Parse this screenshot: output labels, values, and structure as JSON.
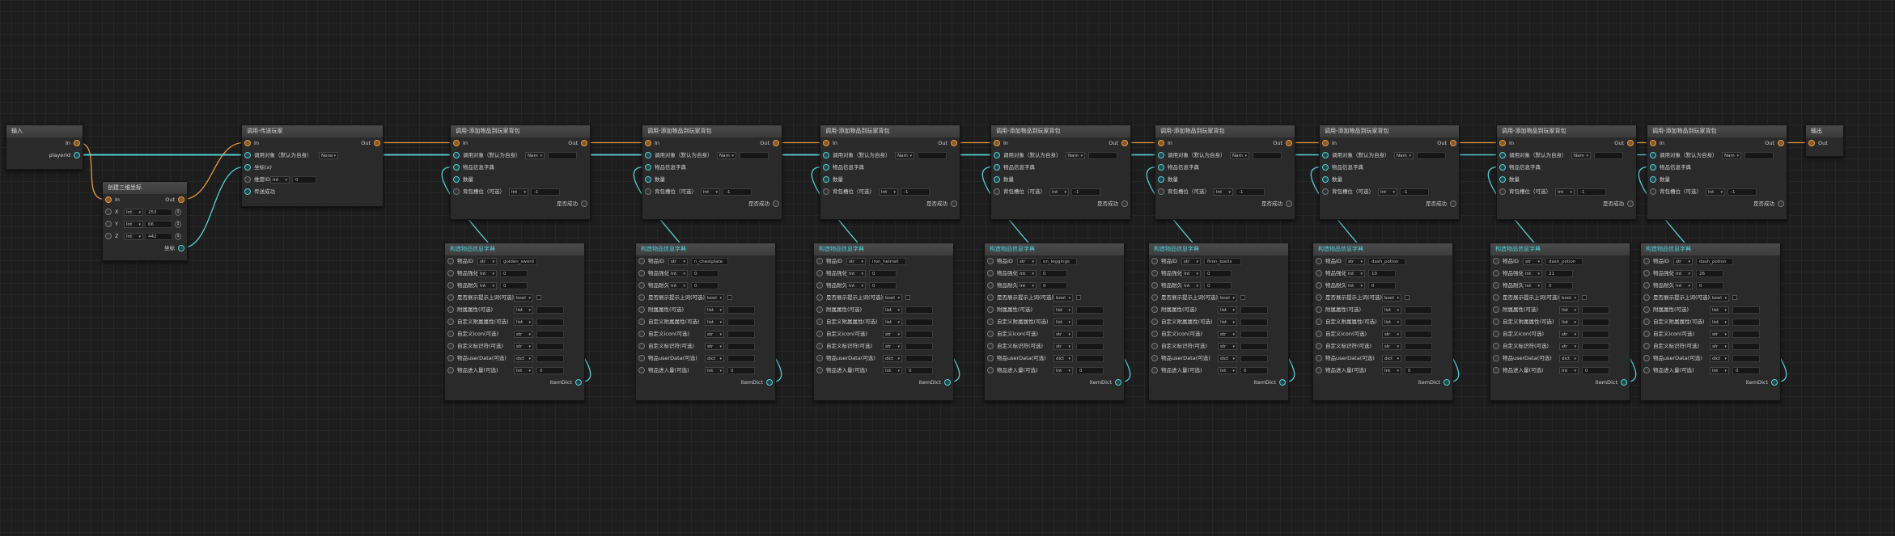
{
  "labels": {
    "in": "In",
    "out": "Out",
    "target": "调用对象（默认为自身）",
    "target_value": "Nam",
    "item_dict": "物品信息字典",
    "count": "数量",
    "slot": "背包槽位（可选）",
    "success": "是否成功",
    "int": "Int",
    "item_id": "物品ID",
    "strength": "物品强化等",
    "durability": "物品耐久",
    "notify": "是否展示提示上词(可选)",
    "attr_a": "附属属性(可选)",
    "attr_b": "自定义附属属性(可选)",
    "custom_icon": "自定义icon(可选)",
    "custom_id": "自定义标识符(可选)",
    "userdata": "物品userData(可选)",
    "enter_time": "物品进入量(可选)",
    "str": "str",
    "bool": "bool",
    "list": "list",
    "dict": "dict",
    "itemdict": "itemDict",
    "true": "True",
    "dash": "-1",
    "zero": "0"
  },
  "input_node": {
    "title": "输入",
    "pin_in": "In",
    "pin_player": "playerId"
  },
  "create_pos_node": {
    "title": "创建三维坐标",
    "pin_in": "In",
    "pin_out": "Out",
    "x": "X",
    "y": "Y",
    "z": "Z",
    "x_val": "253",
    "y_val": "66",
    "z_val": "442",
    "out_pos": "坐标"
  },
  "first_node": {
    "title": "调用-传送玩家",
    "pin_in": "In",
    "pin_out": "Out",
    "target": "调用对象（默认为自身）",
    "target_val": "None",
    "pos": "坐标(x)",
    "rot": "维度ID",
    "rot_val": "0",
    "tp": "传送成功"
  },
  "add_nodes": [
    {
      "title": "调用-添加物品到玩家背包"
    },
    {
      "title": "调用-添加物品到玩家背包"
    },
    {
      "title": "调用-添加物品到玩家背包"
    },
    {
      "title": "调用-添加物品到玩家背包"
    },
    {
      "title": "调用-添加物品到玩家背包"
    },
    {
      "title": "调用-添加物品到玩家背包"
    },
    {
      "title": "调用-添加物品到玩家背包"
    },
    {
      "title": "调用-添加物品到玩家背包"
    }
  ],
  "dict_nodes": [
    {
      "title": "构造物品信息字典",
      "item": "golden_sword",
      "strength": "0",
      "durability": "0"
    },
    {
      "title": "构造物品信息字典",
      "item": "n_chestplate",
      "strength": "0",
      "durability": "0"
    },
    {
      "title": "构造物品信息字典",
      "item": "iron_helmet",
      "strength": "0",
      "durability": "0"
    },
    {
      "title": "构造物品信息字典",
      "item": "on_leggings",
      "strength": "0",
      "durability": "0"
    },
    {
      "title": "构造物品信息字典",
      "item": "firon_boots",
      "strength": "0",
      "durability": "0"
    },
    {
      "title": "构造物品信息字典",
      "item": "dash_potion",
      "strength": "10",
      "durability": "0"
    },
    {
      "title": "构造物品信息字典",
      "item": "dash_potion",
      "strength": "21",
      "durability": "0"
    },
    {
      "title": "构造物品信息字典",
      "item": "dash_potion",
      "strength": "26",
      "durability": "0"
    }
  ],
  "output_node": {
    "title": "输出",
    "pin_out": "Out"
  },
  "colors": {
    "exec": "#e59a42",
    "data": "#59cdd6",
    "title_dict": "#4fd3e0"
  }
}
